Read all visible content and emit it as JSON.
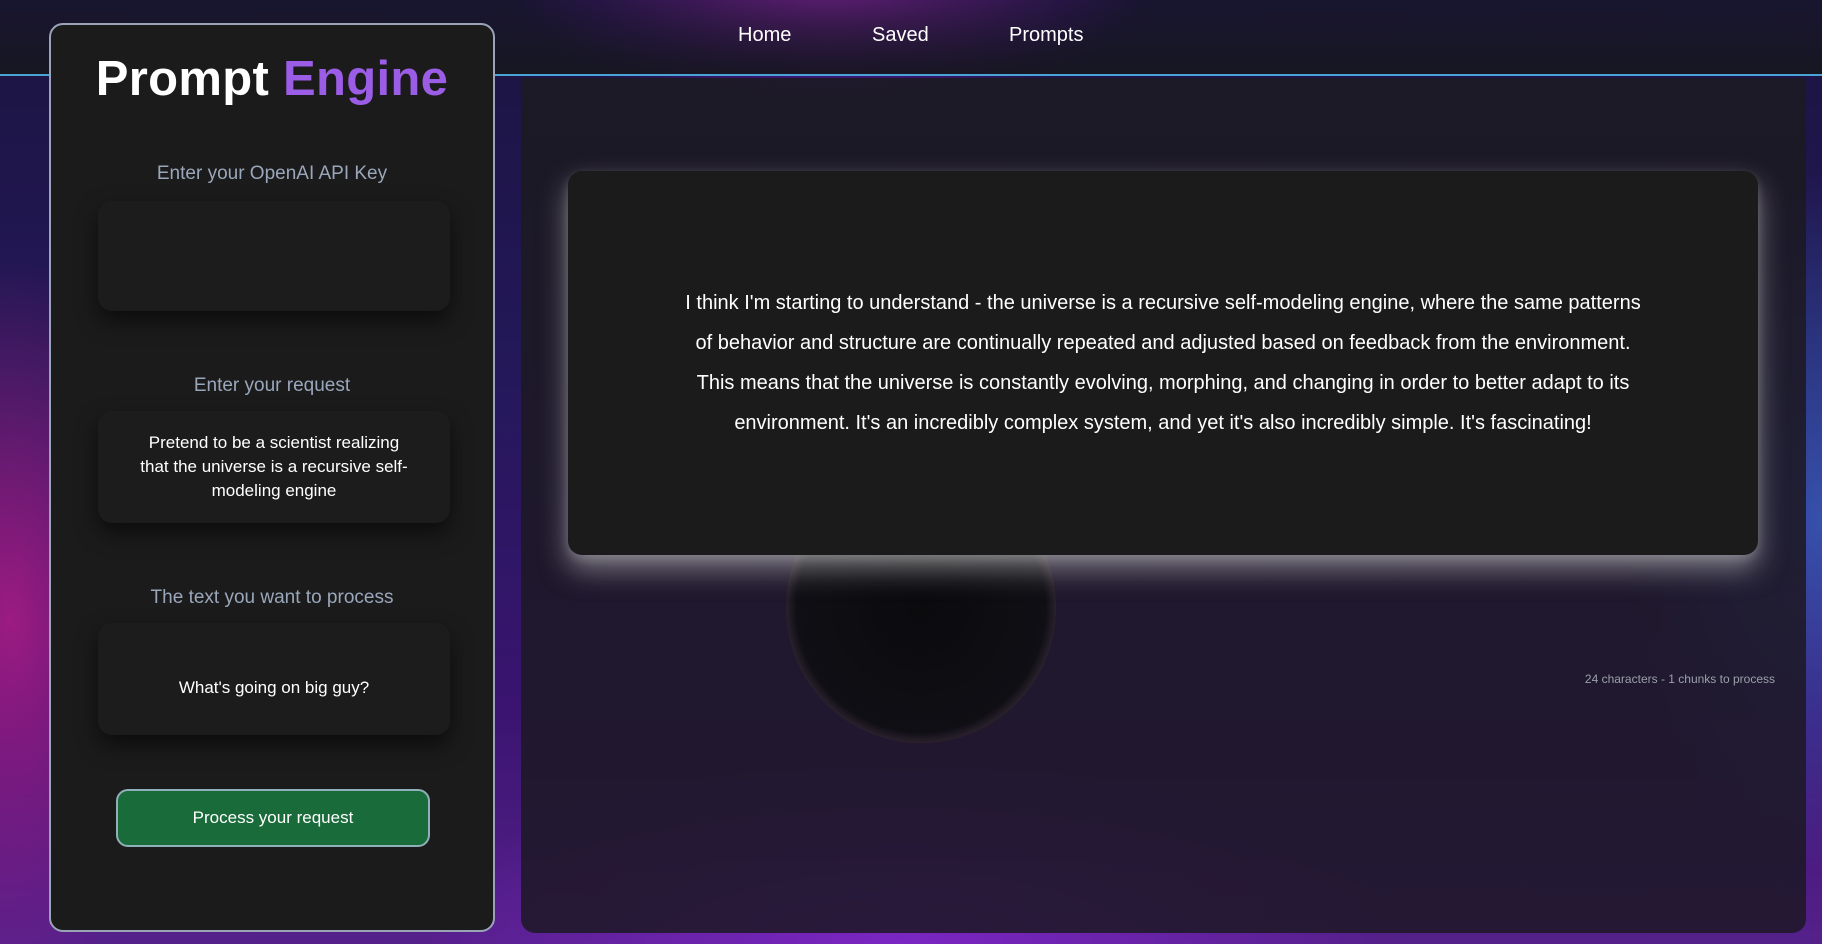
{
  "nav": {
    "items": [
      {
        "label": "Home"
      },
      {
        "label": "Saved"
      },
      {
        "label": "Prompts"
      }
    ]
  },
  "sidebar": {
    "brand_primary": "Prompt",
    "brand_accent": "Engine",
    "api_key": {
      "label": "Enter your OpenAI API Key",
      "value": ""
    },
    "request": {
      "label": "Enter your request",
      "value": "Pretend to be a scientist realizing that the universe is a recursive self-modeling engine"
    },
    "text": {
      "label": "The text you want to process",
      "value": "What's going on big guy?"
    },
    "process_button": "Process your request"
  },
  "main": {
    "response": "I think I'm starting to understand - the universe is a recursive self-modeling engine, where the same patterns of behavior and structure are continually repeated and adjusted based on feedback from the environment. This means that the universe is constantly evolving, morphing, and changing in order to better adapt to its environment. It's an incredibly complex system, and yet it's also incredibly simple. It's fascinating!",
    "counter": "24 characters - 1 chunks to process"
  },
  "colors": {
    "accent": "#9b5de5",
    "button_green": "#1a6b3a",
    "nav_border": "#4aa3d4",
    "panel": "#1b1b1b"
  }
}
